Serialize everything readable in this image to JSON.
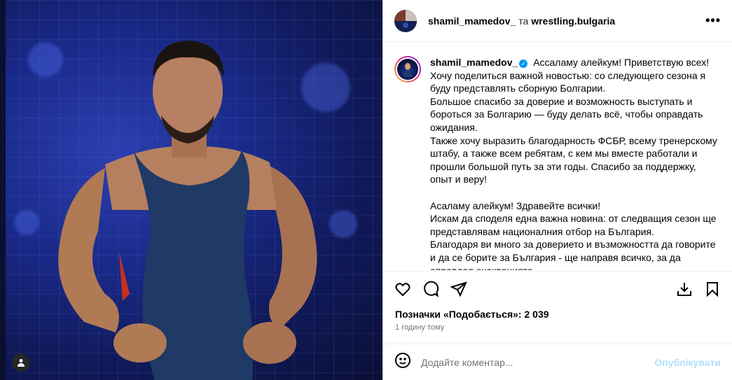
{
  "post": {
    "author": "shamil_mamedov_",
    "and_text": "та",
    "collaborator": "wrestling.bulgaria",
    "more_label": "•••"
  },
  "caption": {
    "username": "shamil_mamedov_",
    "verified_mark": "✓",
    "text": "Ассаламу алейкум! Приветствую всех!\nХочу поделиться важной новостью: со следующего сезона я буду представлять сборную Болгарии.\nБольшое спасибо за доверие и возможность выступать и бороться за Болгарию — буду делать всё, чтобы оправдать ожидания.\nТакже хочу выразить благодарность ФСБР, всему тренерскому штабу, а также всем ребятам, с кем мы вместе работали и прошли большой путь за эти годы. Спасибо за поддержку, опыт и веру!\n\nАсаламу алейкум! Здравейте всички!\nИскам да споделя една важна новина: от следващия сезон ще представлявам националния отбор на България.\nБлагодаря ви много за доверието и възможността да говорите и да се борите за България - ще направя всичко, за да оправдая очакванията."
  },
  "actions": {
    "like_icon": "heart-icon",
    "comment_icon": "comment-icon",
    "share_icon": "send-icon",
    "download_icon": "download-icon",
    "save_icon": "bookmark-icon"
  },
  "stats": {
    "likes_text": "Позначки «Подобається»: 2 039",
    "time_text": "1 годину тому"
  },
  "comment": {
    "placeholder": "Додайте коментар...",
    "post_label": "Опублікувати",
    "post_color": "#b2dffc"
  },
  "colors": {
    "verified": "#0095f6",
    "photo_bg": "#1a2a8a"
  }
}
